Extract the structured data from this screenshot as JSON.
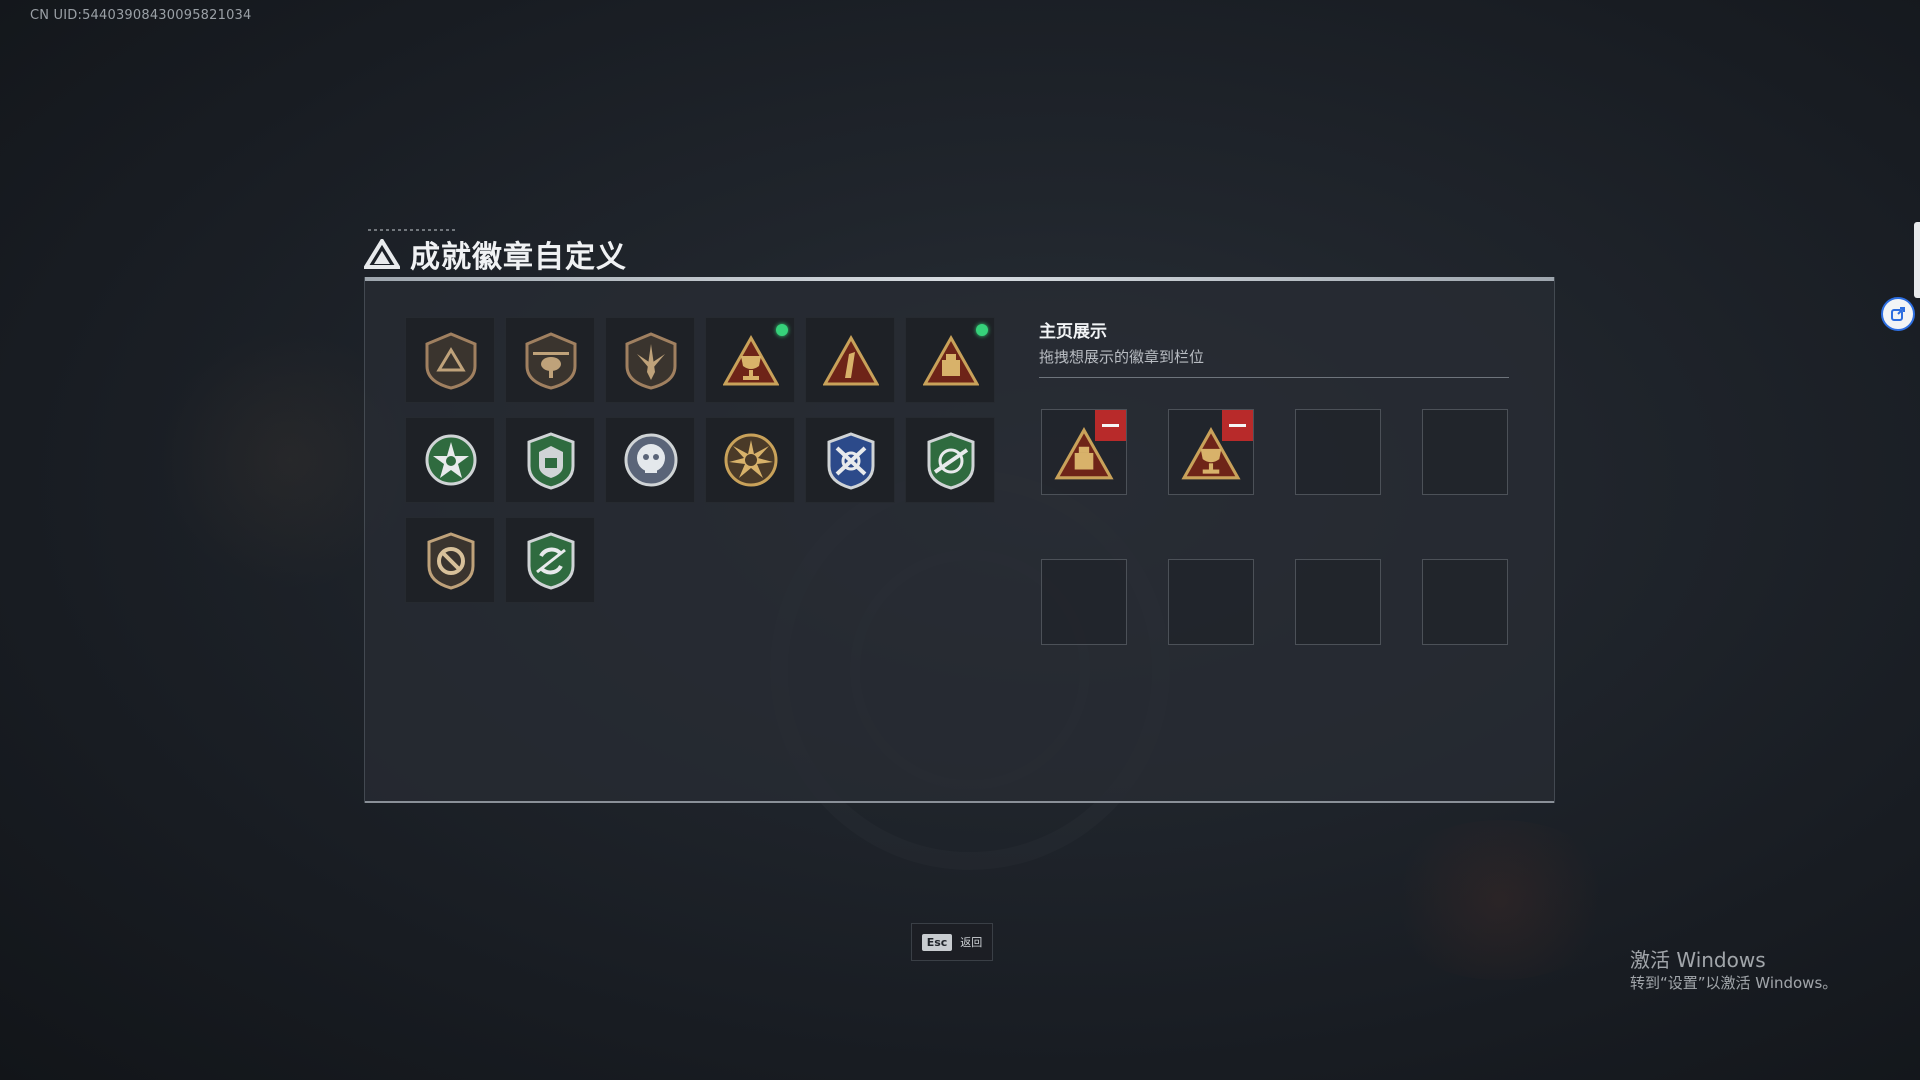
{
  "uid_label": "CN UID:5440390843009582103​4",
  "title": "成就徽章自定义",
  "esc": {
    "key": "Esc",
    "label": "返回"
  },
  "showcase": {
    "title": "主页展示",
    "subtitle": "拖拽想展示的徽章到栏位",
    "slots": [
      {
        "badge": "triangle-box-badge",
        "filled": true
      },
      {
        "badge": "triangle-trophy-badge",
        "filled": true
      },
      {
        "badge": "",
        "filled": false
      },
      {
        "badge": "",
        "filled": false
      },
      {
        "badge": "",
        "filled": false
      },
      {
        "badge": "",
        "filled": false
      },
      {
        "badge": "",
        "filled": false
      },
      {
        "badge": "",
        "filled": false
      }
    ]
  },
  "badges": [
    {
      "icon": "shield-triangle-icon",
      "new": false
    },
    {
      "icon": "shield-helicopter-icon",
      "new": false
    },
    {
      "icon": "shield-dagger-icon",
      "new": false
    },
    {
      "icon": "triangle-trophy-icon",
      "new": true
    },
    {
      "icon": "triangle-number-one-icon",
      "new": false
    },
    {
      "icon": "triangle-box-icon",
      "new": true
    },
    {
      "icon": "green-star-medal-icon",
      "new": false
    },
    {
      "icon": "green-shield-medal-icon",
      "new": false
    },
    {
      "icon": "silver-skull-medal-icon",
      "new": false
    },
    {
      "icon": "gold-sunburst-medal-icon",
      "new": false
    },
    {
      "icon": "blue-crossed-rifles-icon",
      "new": false
    },
    {
      "icon": "green-crosshair-rifle-icon",
      "new": false
    },
    {
      "icon": "bronze-no-sign-shield-icon",
      "new": false
    },
    {
      "icon": "green-cycle-shield-icon",
      "new": false
    }
  ],
  "colors": {
    "new_indicator": "#36d27a",
    "remove_button": "#b82a2a",
    "gold": "#c9a25a",
    "bronze": "#a08060",
    "green": "#2f6b3f",
    "blue": "#2c4a8a"
  },
  "watermark": {
    "line1": "激活 Windows",
    "line2": "转到“设置”以激活 Windows。"
  }
}
